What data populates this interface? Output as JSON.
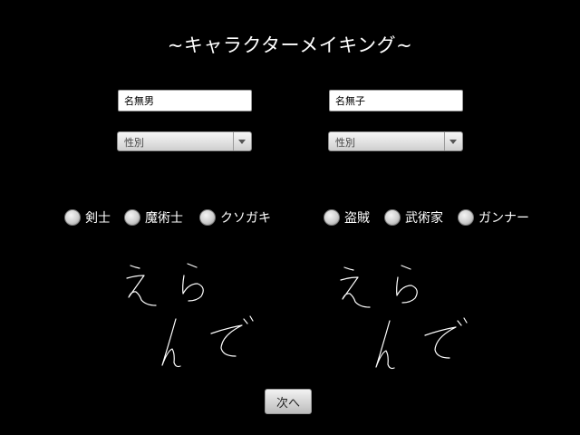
{
  "title": "~キャラクターメイキング~",
  "left_character": {
    "name_value": "名無男",
    "gender_select": "性別"
  },
  "right_character": {
    "name_value": "名無子",
    "gender_select": "性別"
  },
  "left_classes": [
    "剣士",
    "魔術士",
    "クソガキ"
  ],
  "right_classes": [
    "盗賊",
    "武術家",
    "ガンナー"
  ],
  "next_button_label": "次へ"
}
